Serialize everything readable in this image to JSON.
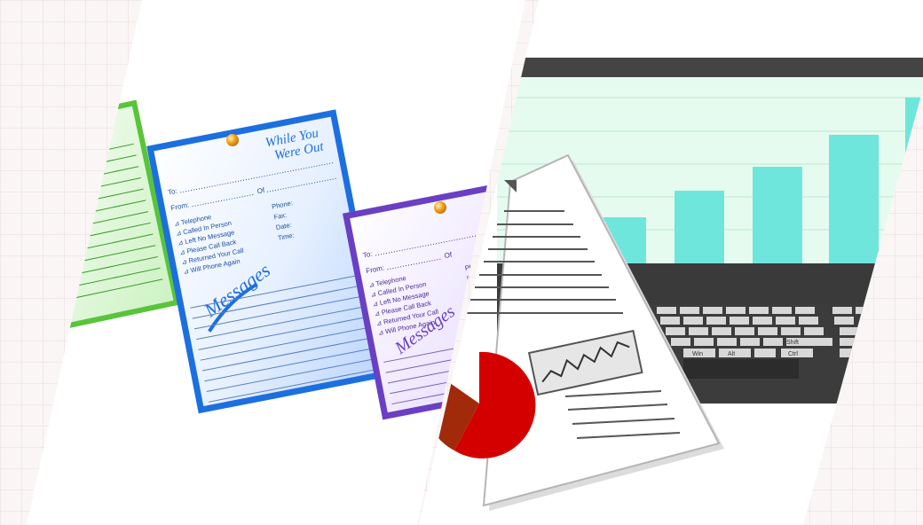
{
  "notepad_blue": {
    "title_line1": "While You",
    "title_line2": "Were Out",
    "to_label": "To:",
    "from_label": "From:",
    "of_label": "Of",
    "checklist": [
      "Telephone",
      "Called In Person",
      "Left No Message",
      "Please Call Back",
      "Returned Your Call",
      "Will Phone Again"
    ],
    "fields": [
      "Phone:",
      "Fax:",
      "Date:",
      "Time:"
    ],
    "messages_label": "Messages"
  },
  "notepad_purple": {
    "to_label": "To:",
    "from_label": "From:",
    "of_label": "Of",
    "checklist": [
      "Telephone",
      "Called In Person",
      "Left No Message",
      "Please Call Back",
      "Returned Your Call",
      "Will Phone Again"
    ],
    "fields": [
      "Phone",
      "Fax"
    ],
    "messages_label": "Messages"
  },
  "keyboard": {
    "keys": [
      "Win",
      "Alt",
      "Ctrl",
      "Shift"
    ]
  },
  "colors": {
    "blue_pad": "#1c6fe0",
    "purple_pad": "#6a3fc4",
    "green_pad": "#58c43a",
    "bar": "#6ee6dc",
    "pie_red": "#d40000",
    "pie_brown": "#a12a0a"
  }
}
